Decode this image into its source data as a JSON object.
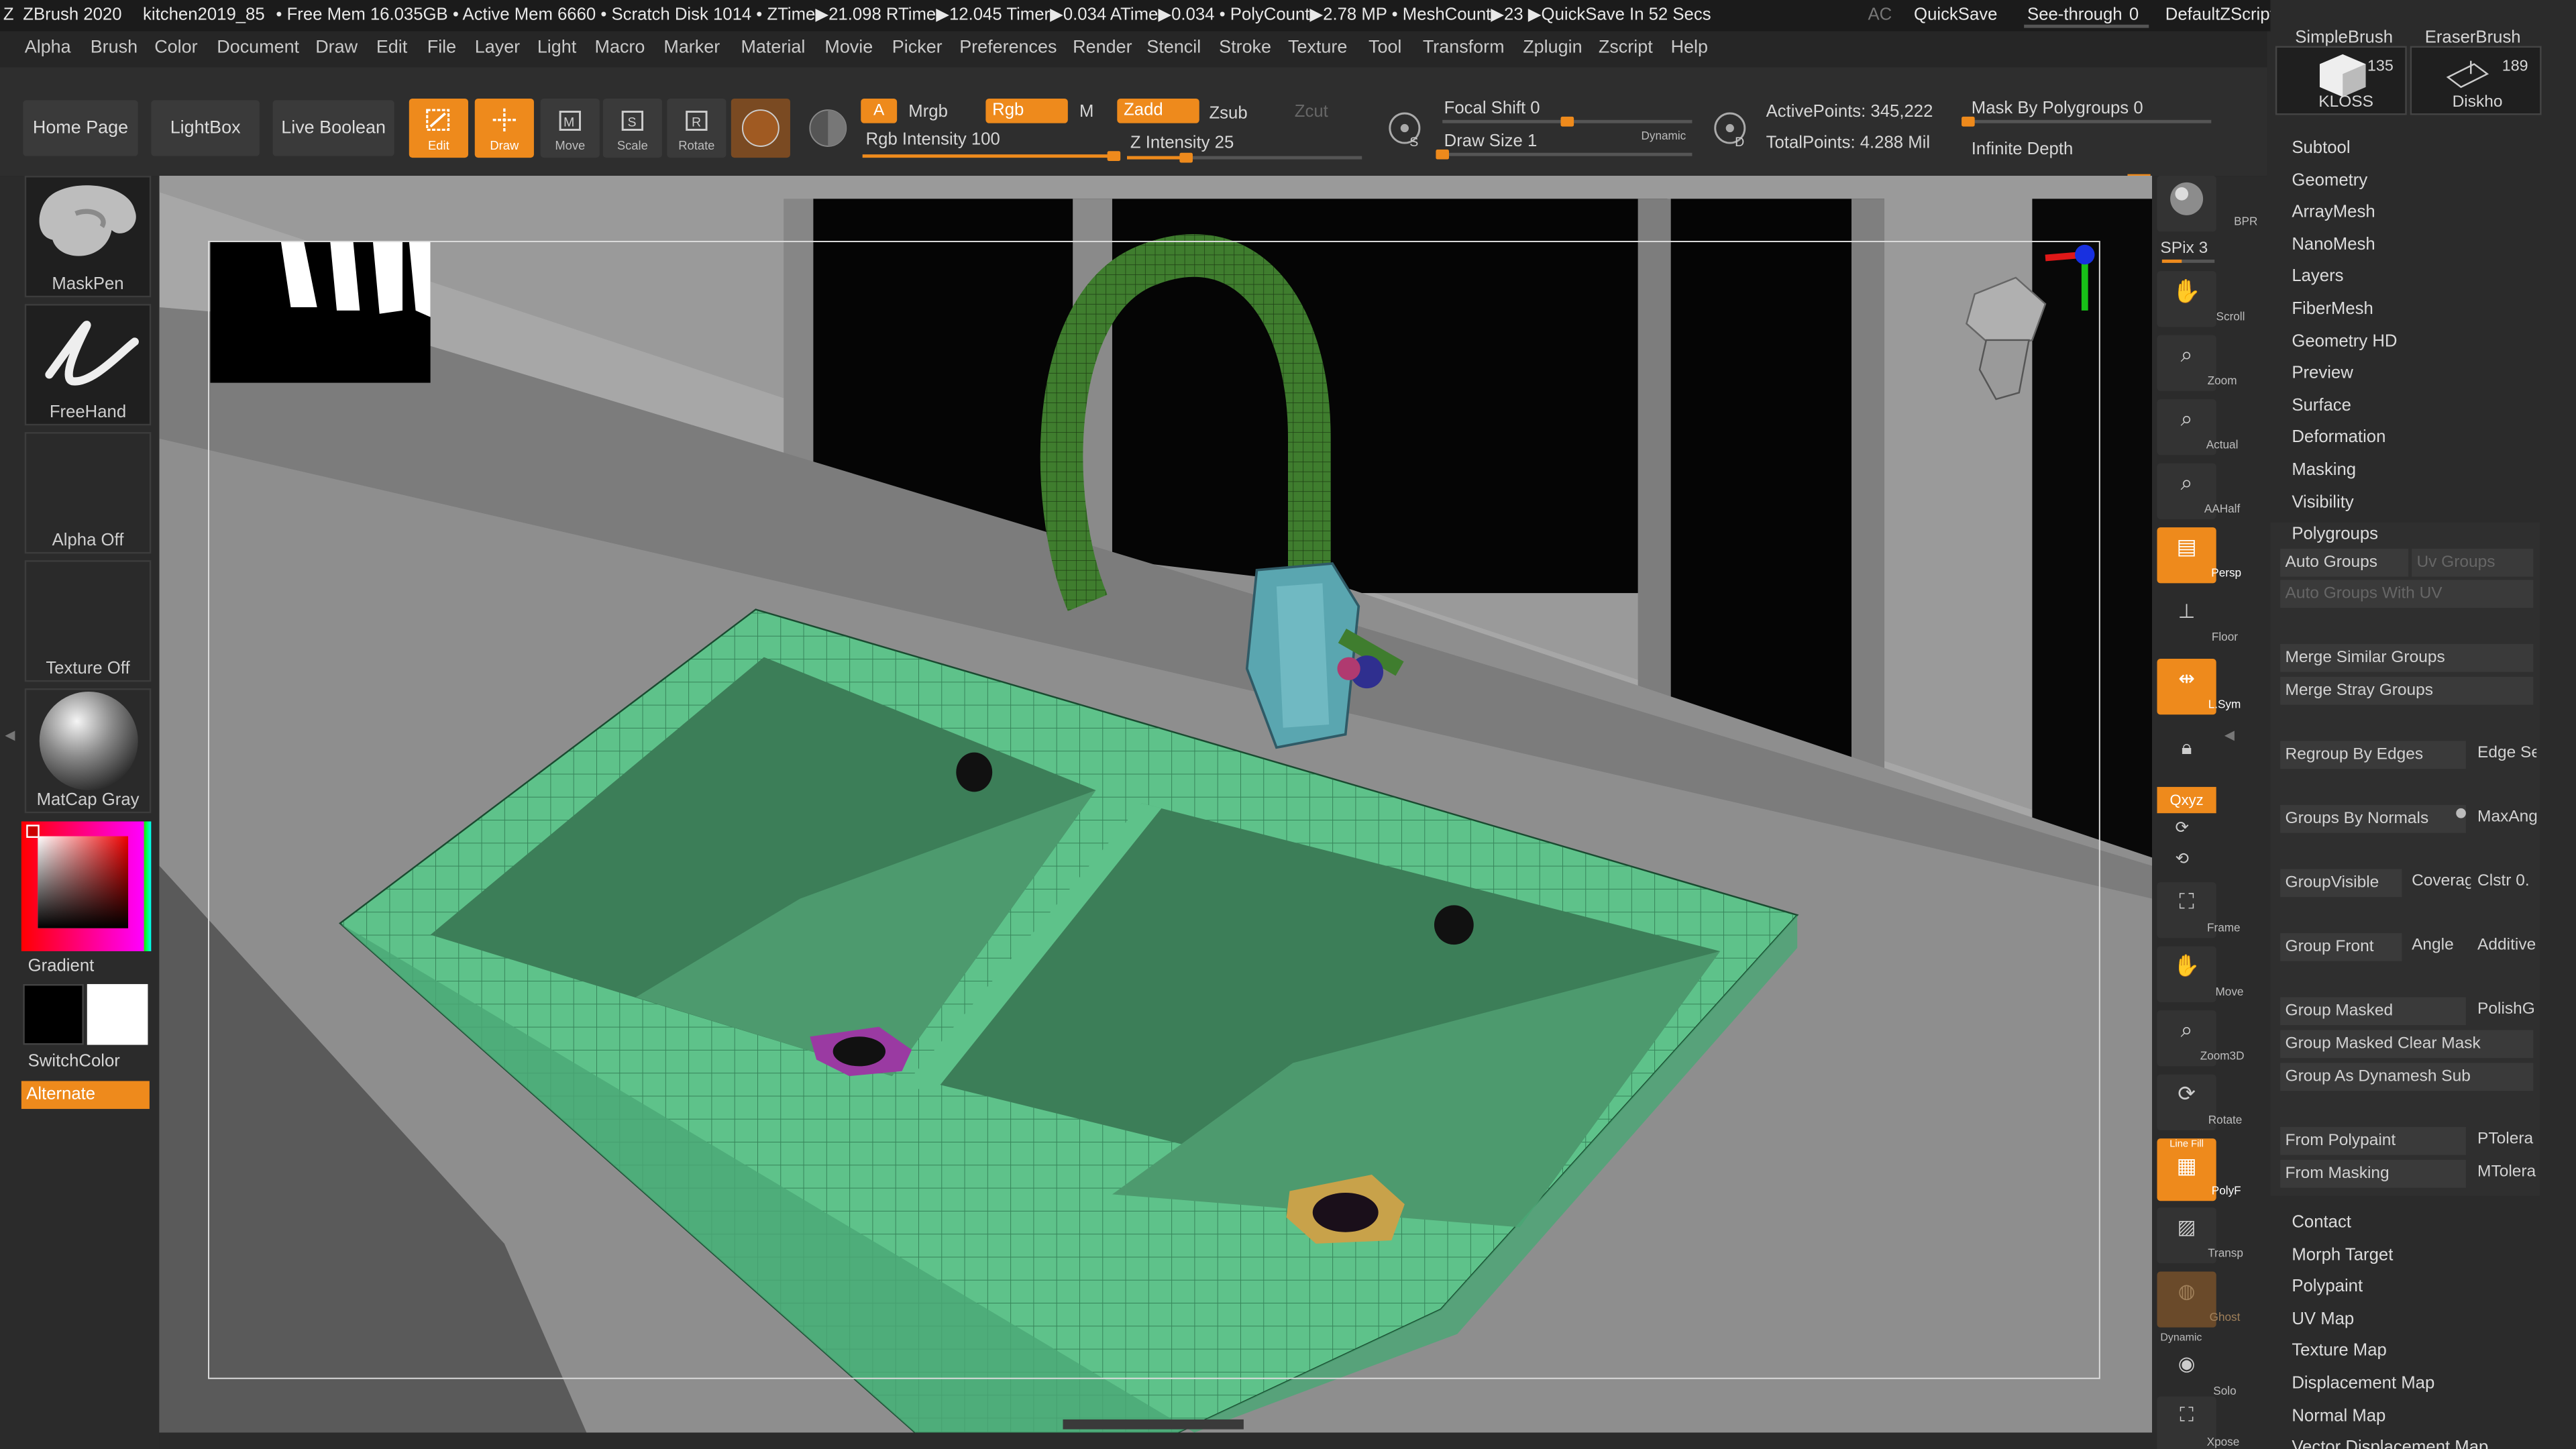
{
  "title_bar": {
    "app": "ZBrush 2020",
    "document": "kitchen2019_85",
    "stats": "• Free Mem 16.035GB • Active Mem 6660 • Scratch Disk 1014 •  ZTime▶21.098 RTime▶12.045 Timer▶0.034 ATime▶0.034 • PolyCount▶2.78 MP  • MeshCount▶23  ▶QuickSave In 52 Secs",
    "ac": "AC",
    "quicksave": "QuickSave",
    "see_through_label": "See-through",
    "see_through_value": "0",
    "script": "DefaultZScript"
  },
  "menu": [
    "Alpha",
    "Brush",
    "Color",
    "Document",
    "Draw",
    "Edit",
    "File",
    "Layer",
    "Light",
    "Macro",
    "Marker",
    "Material",
    "Movie",
    "Picker",
    "Preferences",
    "Render",
    "Stencil",
    "Stroke",
    "Texture",
    "Tool",
    "Transform",
    "Zplugin",
    "Zscript",
    "Help"
  ],
  "toolbar": {
    "home_page": "Home Page",
    "lightbox": "LightBox",
    "live_boolean": "Live Boolean",
    "edit": "Edit",
    "draw": "Draw",
    "move": "Move",
    "scale": "Scale",
    "rotate": "Rotate",
    "a": "A",
    "mrgb": "Mrgb",
    "rgb": "Rgb",
    "m": "M",
    "zadd": "Zadd",
    "zsub": "Zsub",
    "zcut": "Zcut",
    "rgb_intensity_label": "Rgb Intensity",
    "rgb_intensity_value": "100",
    "rgb_intensity_level": 1.0,
    "z_intensity_label": "Z Intensity",
    "z_intensity_value": "25",
    "z_intensity_level": 0.25,
    "focal_shift_label": "Focal Shift",
    "focal_shift_value": "0",
    "focal_shift_level": 0.5,
    "draw_size_label": "Draw Size",
    "draw_size_value": "1",
    "draw_size_level": 0.0,
    "dynamic": "Dynamic",
    "s_label": "S",
    "d_label": "D",
    "active_points": "ActivePoints: 345,222",
    "total_points": "TotalPoints: 4.288 Mil",
    "mask_by_polygroups_label": "Mask By Polygroups",
    "mask_by_polygroups_value": "0",
    "mask_by_polygroups_level": 0.0,
    "infinite_depth": "Infinite Depth"
  },
  "left_shelf": {
    "maskpen": "MaskPen",
    "freehand": "FreeHand",
    "alpha_off": "Alpha Off",
    "texture_off": "Texture Off",
    "matcap": "MatCap Gray",
    "gradient": "Gradient",
    "switchcolor": "SwitchColor",
    "alternate": "Alternate"
  },
  "right_shelf": {
    "bpr": "BPR",
    "spix_label": "SPix",
    "spix_value": "3",
    "spix_level": 0.375,
    "scroll": "Scroll",
    "zoom": "Zoom",
    "actual": "Actual",
    "aahalf": "AAHalf",
    "persp": "Persp",
    "floor": "Floor",
    "lsym": "L.Sym",
    "xyz": "Qxyz",
    "frame": "Frame",
    "move": "Move",
    "zoom3d": "Zoom3D",
    "rotate": "Rotate",
    "linefill": "Line Fill",
    "polyf": "PolyF",
    "transp": "Transp",
    "ghost": "Ghost",
    "dynamic": "Dynamic",
    "solo": "Solo",
    "xpose": "Xpose"
  },
  "palette": {
    "brushes": [
      {
        "name": "SimpleBrush",
        "label": "KLOSS",
        "count": "135"
      },
      {
        "name": "EraserBrush",
        "label": "Diskho",
        "count": "189"
      }
    ],
    "sections": [
      "Subtool",
      "Geometry",
      "ArrayMesh",
      "NanoMesh",
      "Layers",
      "FiberMesh",
      "Geometry HD",
      "Preview",
      "Surface",
      "Deformation",
      "Masking",
      "Visibility"
    ],
    "polygroups": "Polygroups",
    "auto_groups": "Auto Groups",
    "uv_groups": "Uv Groups",
    "auto_groups_uv": "Auto Groups With UV",
    "merge_similar": "Merge Similar Groups",
    "merge_stray": "Merge Stray Groups",
    "regroup_edges": "Regroup By Edges",
    "edge_se": "Edge Se",
    "groups_normals": "Groups By Normals",
    "maxang": "MaxAng",
    "groupvisible": "GroupVisible",
    "coverage": "Coverag",
    "clstr": "Clstr 0.",
    "group_front": "Group Front",
    "angle": "Angle",
    "additive": "Additive",
    "group_masked": "Group Masked",
    "polishg": "PolishG",
    "group_masked_clear": "Group Masked Clear Mask",
    "group_dynamesh": "Group As Dynamesh Sub",
    "from_polypaint": "From Polypaint",
    "ptolera": "PTolera",
    "from_masking": "From Masking",
    "mtolera": "MTolera",
    "sections_after": [
      "Contact",
      "Morph Target",
      "Polypaint",
      "UV Map",
      "Texture Map",
      "Displacement Map",
      "Normal Map",
      "Vector Displacement Map"
    ]
  }
}
